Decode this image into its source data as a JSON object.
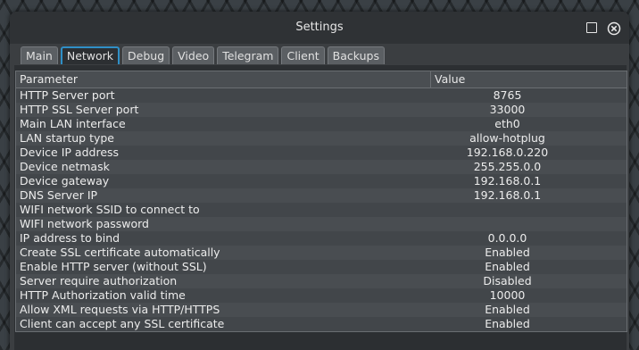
{
  "window": {
    "title": "Settings"
  },
  "tabs": [
    {
      "label": "Main",
      "active": false
    },
    {
      "label": "Network",
      "active": true
    },
    {
      "label": "Debug",
      "active": false
    },
    {
      "label": "Video",
      "active": false
    },
    {
      "label": "Telegram",
      "active": false
    },
    {
      "label": "Client",
      "active": false
    },
    {
      "label": "Backups",
      "active": false
    }
  ],
  "grid": {
    "headers": {
      "param": "Parameter",
      "value": "Value"
    },
    "rows": [
      {
        "param": "HTTP Server port",
        "value": "8765"
      },
      {
        "param": "HTTP SSL Server port",
        "value": "33000"
      },
      {
        "param": "Main LAN interface",
        "value": "eth0"
      },
      {
        "param": "LAN startup type",
        "value": "allow-hotplug"
      },
      {
        "param": "Device IP address",
        "value": "192.168.0.220"
      },
      {
        "param": "Device netmask",
        "value": "255.255.0.0"
      },
      {
        "param": "Device gateway",
        "value": "192.168.0.1"
      },
      {
        "param": "DNS Server IP",
        "value": "192.168.0.1"
      },
      {
        "param": "WIFI network SSID to connect to",
        "value": ""
      },
      {
        "param": "WIFI network password",
        "value": ""
      },
      {
        "param": "IP address to bind",
        "value": "0.0.0.0"
      },
      {
        "param": "Create SSL certificate automatically",
        "value": "Enabled"
      },
      {
        "param": "Enable HTTP server (without SSL)",
        "value": "Enabled"
      },
      {
        "param": "Server require authorization",
        "value": "Disabled"
      },
      {
        "param": "HTTP Authorization valid time",
        "value": "10000"
      },
      {
        "param": "Allow XML requests via HTTP/HTTPS",
        "value": "Enabled"
      },
      {
        "param": "Client can accept any SSL certificate",
        "value": "Enabled"
      }
    ]
  },
  "icons": {
    "maximize": "maximize-icon",
    "close": "close-circle-icon"
  },
  "colors": {
    "accent": "#2f8fc6",
    "window_bg": "#3b3e41",
    "row_odd": "#42464a",
    "row_even": "#494d51"
  }
}
